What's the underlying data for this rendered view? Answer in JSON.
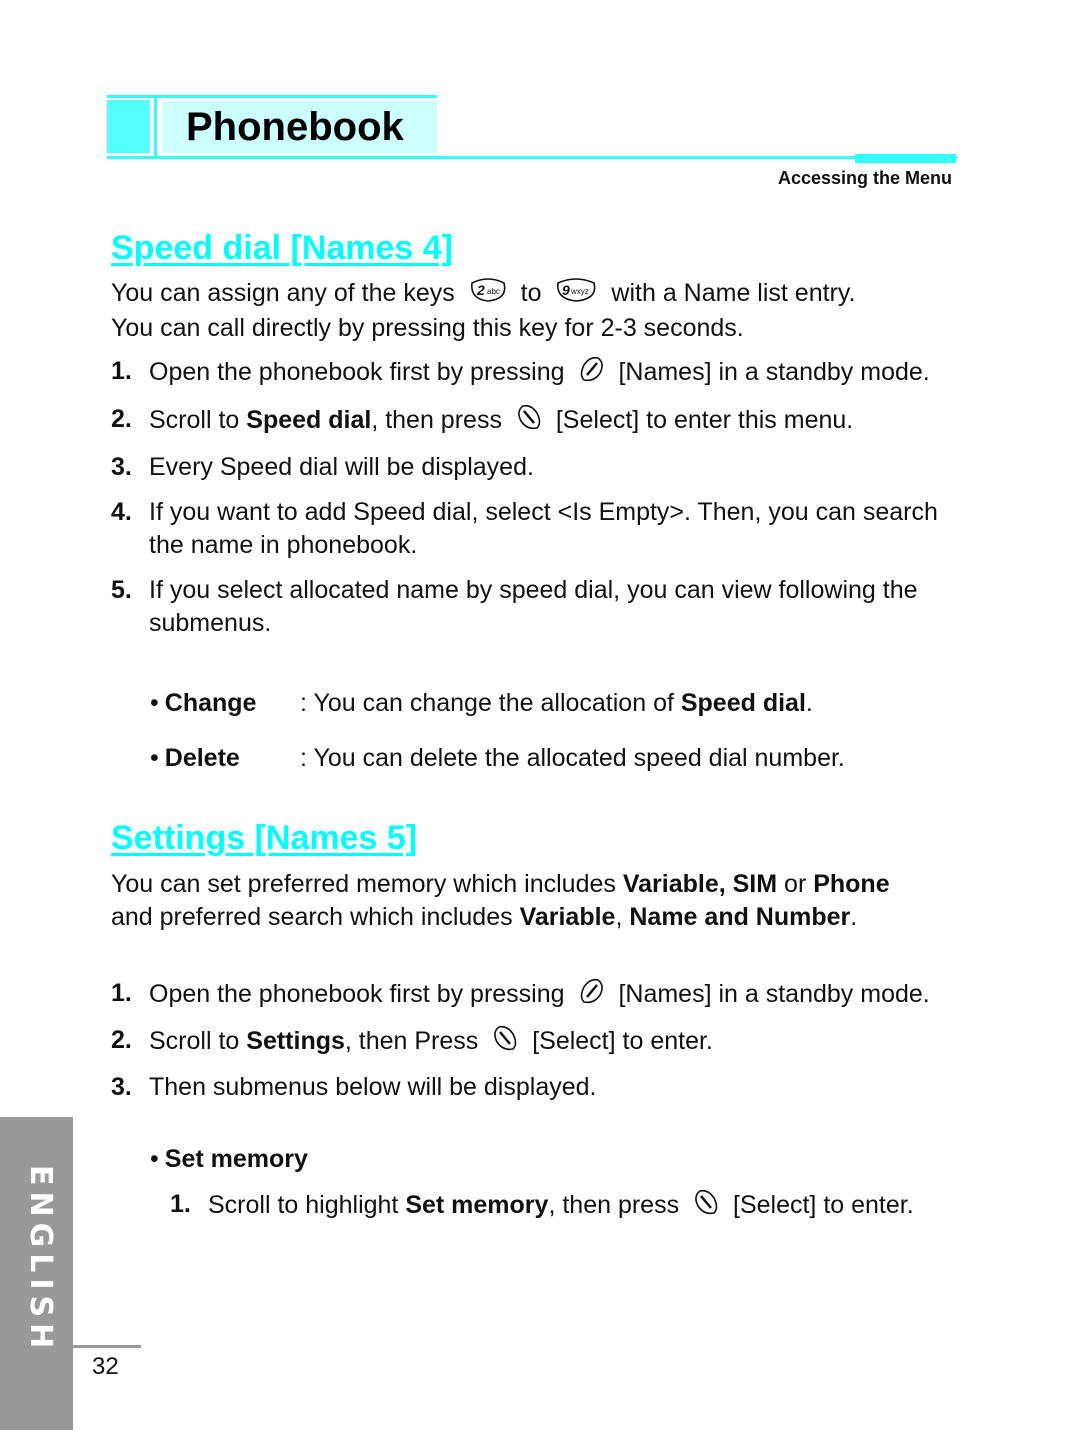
{
  "header": {
    "title": "Phonebook",
    "subtitle": "Accessing the Menu",
    "accent_color": "#33ffff"
  },
  "speed_dial": {
    "title": "Speed dial [Names 4]",
    "intro": {
      "part1": "You can assign any of the keys",
      "key_from": {
        "icon": "key-2abc-icon",
        "digit": "2",
        "letters": "abc"
      },
      "to": "to",
      "key_to": {
        "icon": "key-9wxyz-icon",
        "digit": "9",
        "letters": "wxyz"
      },
      "part2": "with a Name list entry.",
      "line2": "You can call directly by pressing this key for 2-3 seconds."
    },
    "steps": [
      {
        "num": "1.",
        "pre": "Open the phonebook first by pressing",
        "icon": "names-softkey-icon",
        "post": "[Names] in a standby mode."
      },
      {
        "num": "2.",
        "pre": "Scroll to ",
        "bold": "Speed dial",
        "mid": ", then press",
        "icon": "select-softkey-icon",
        "post": "[Select] to enter this menu."
      },
      {
        "num": "3.",
        "text": "Every Speed dial will be displayed."
      },
      {
        "num": "4.",
        "text": "If you want to add Speed dial, select <Is Empty>. Then, you can search the name in phonebook."
      },
      {
        "num": "5.",
        "text": "If you select allocated name by speed dial, you can view following the submenus."
      }
    ],
    "submenus": [
      {
        "label": "Change",
        "desc_pre": ": You can change the allocation of ",
        "desc_bold": "Speed dial",
        "desc_post": "."
      },
      {
        "label": "Delete",
        "desc_pre": ": You can delete the allocated speed dial number.",
        "desc_bold": "",
        "desc_post": ""
      }
    ]
  },
  "settings": {
    "title": "Settings [Names 5]",
    "intro": {
      "t1": "You can set preferred memory which includes ",
      "b1": "Variable, SIM",
      "t2": " or ",
      "b2": "Phone",
      "t3": " and preferred search which includes ",
      "b3": "Variable",
      "t4": ", ",
      "b4": "Name and Number",
      "t5": "."
    },
    "steps": [
      {
        "num": "1.",
        "pre": "Open the phonebook first by pressing",
        "icon": "names-softkey-icon",
        "post": "[Names] in a standby mode."
      },
      {
        "num": "2.",
        "pre": "Scroll to ",
        "bold": "Settings",
        "mid": ", then Press",
        "icon": "select-softkey-icon",
        "post": "[Select] to enter."
      },
      {
        "num": "3.",
        "text": "Then submenus below will be displayed."
      }
    ],
    "set_memory": {
      "label": "Set memory",
      "steps": [
        {
          "num": "1.",
          "pre": "Scroll to highlight ",
          "bold": "Set memory",
          "mid": ", then press",
          "icon": "select-softkey-icon",
          "post": "[Select] to enter."
        }
      ]
    }
  },
  "side_tab": {
    "label": "ENGLISH",
    "color": "#999999"
  },
  "page_number": "32"
}
